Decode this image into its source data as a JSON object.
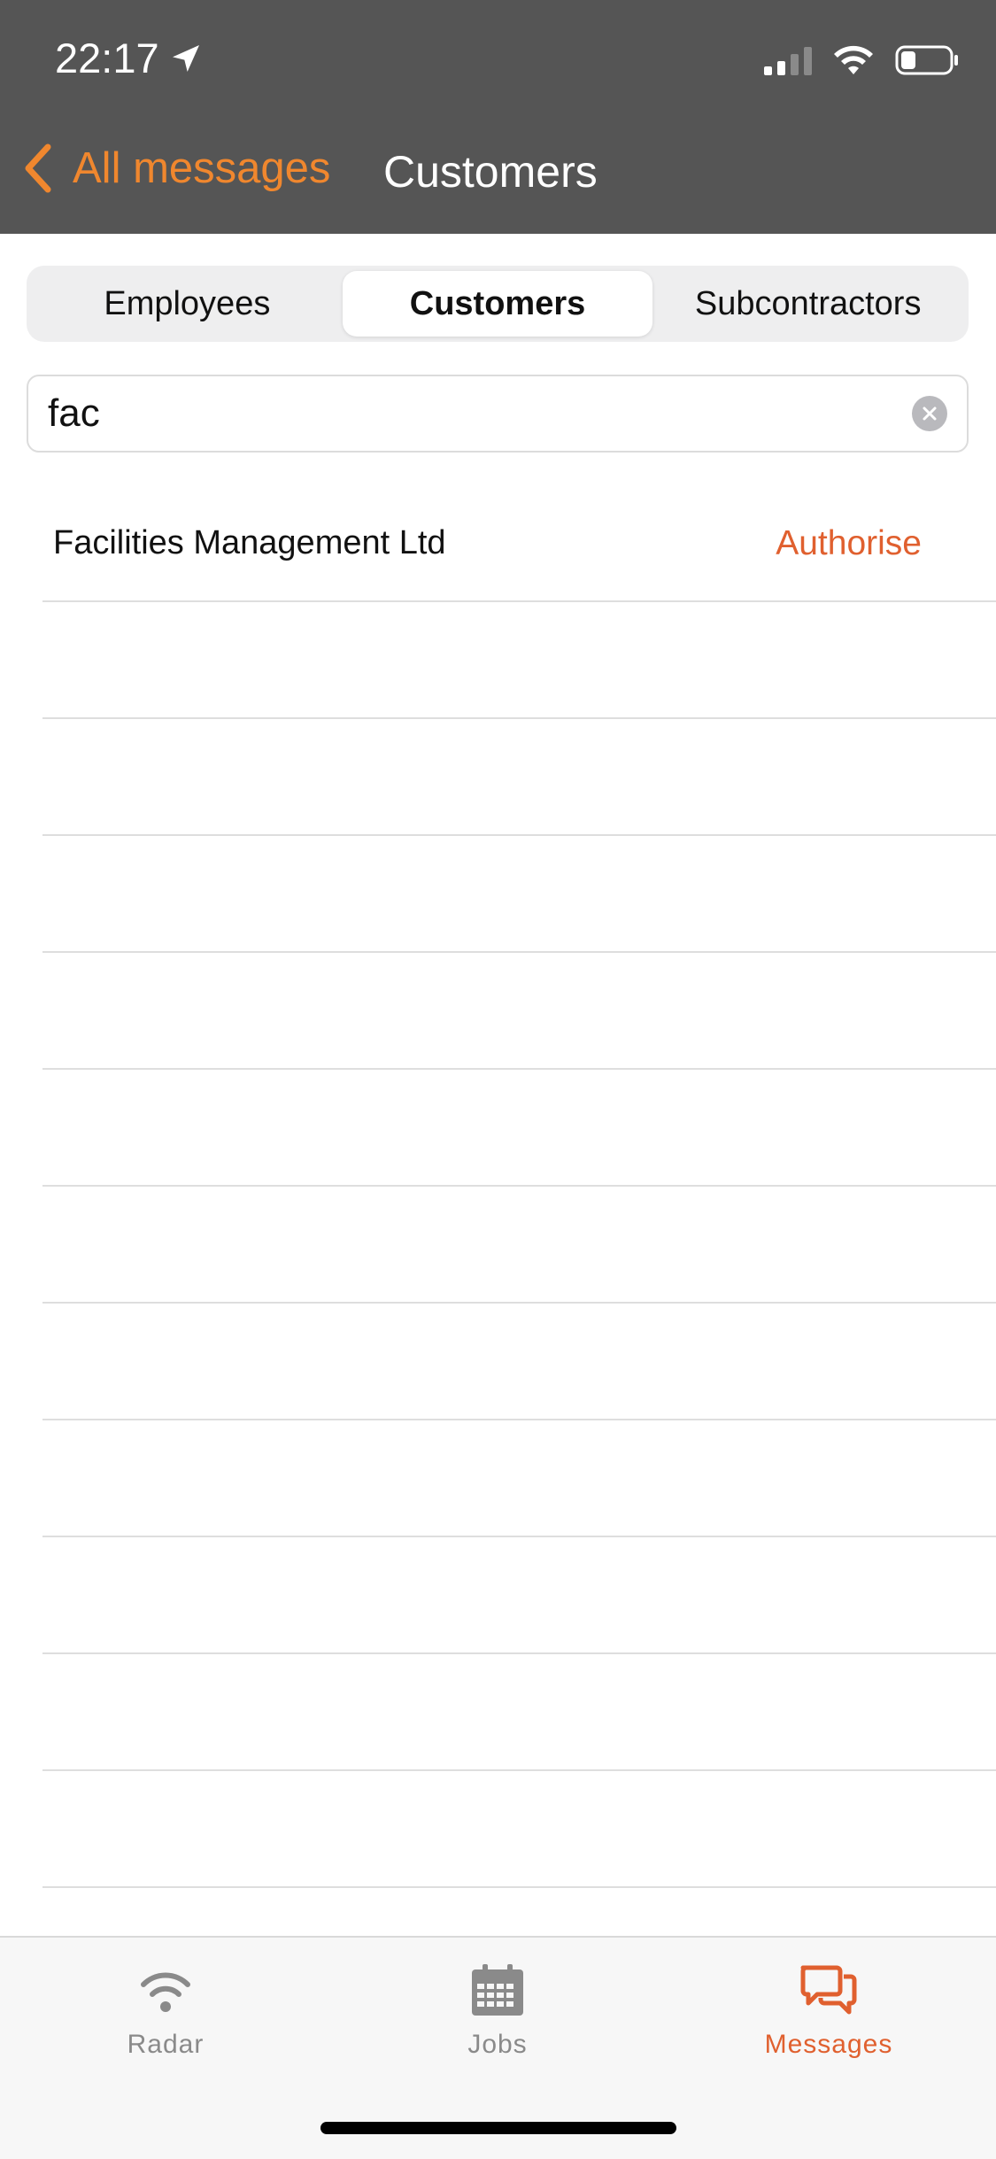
{
  "status_bar": {
    "time": "22:17"
  },
  "nav": {
    "back_label": "All messages",
    "title": "Customers"
  },
  "segments": [
    {
      "label": "Employees",
      "active": false
    },
    {
      "label": "Customers",
      "active": true
    },
    {
      "label": "Subcontractors",
      "active": false
    }
  ],
  "search": {
    "value": "fac"
  },
  "results": [
    {
      "name": "Facilities Management Ltd",
      "action": "Authorise"
    }
  ],
  "tabbar": {
    "items": [
      {
        "label": "Radar",
        "icon": "radar-wifi-icon"
      },
      {
        "label": "Jobs",
        "icon": "calendar-icon"
      },
      {
        "label": "Messages",
        "icon": "chat-bubbles-icon",
        "active": true
      }
    ]
  },
  "colors": {
    "accent": "#f0872e",
    "action": "#e0602f",
    "header": "#555555"
  }
}
